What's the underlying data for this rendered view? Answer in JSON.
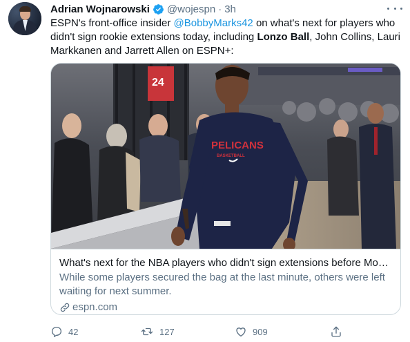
{
  "author": {
    "name": "Adrian Wojnarowski",
    "handle": "@wojespn",
    "separator": "·",
    "time": "3h"
  },
  "tweet": {
    "text_1": "ESPN's front-office insider ",
    "mention": "@BobbyMarks42",
    "text_2": " on what's next for players who didn't sign rookie extensions today, including ",
    "bold_name": "Lonzo Ball",
    "text_3": ", John Collins, Lauri Markkanen and Jarrett Allen on ESPN+:"
  },
  "card": {
    "title": "What's next for the NBA players who didn't sign extensions before Mon...",
    "description": "While some players secured the bag at the last minute, others were left waiting for next summer.",
    "domain": "espn.com",
    "photo": {
      "jersey_text": "PELICANS",
      "jersey_subtext": "BASKETBALL",
      "jersey_number": "24"
    }
  },
  "actions": {
    "replies": "42",
    "retweets": "127",
    "likes": "909"
  },
  "colors": {
    "link": "#1b95e0",
    "secondary_text": "#5b7083",
    "border": "#cfd9de",
    "verified": "#1da1f2"
  },
  "icons": [
    "verified-icon",
    "more-icon",
    "link-icon",
    "reply-icon",
    "retweet-icon",
    "like-icon",
    "share-icon"
  ]
}
